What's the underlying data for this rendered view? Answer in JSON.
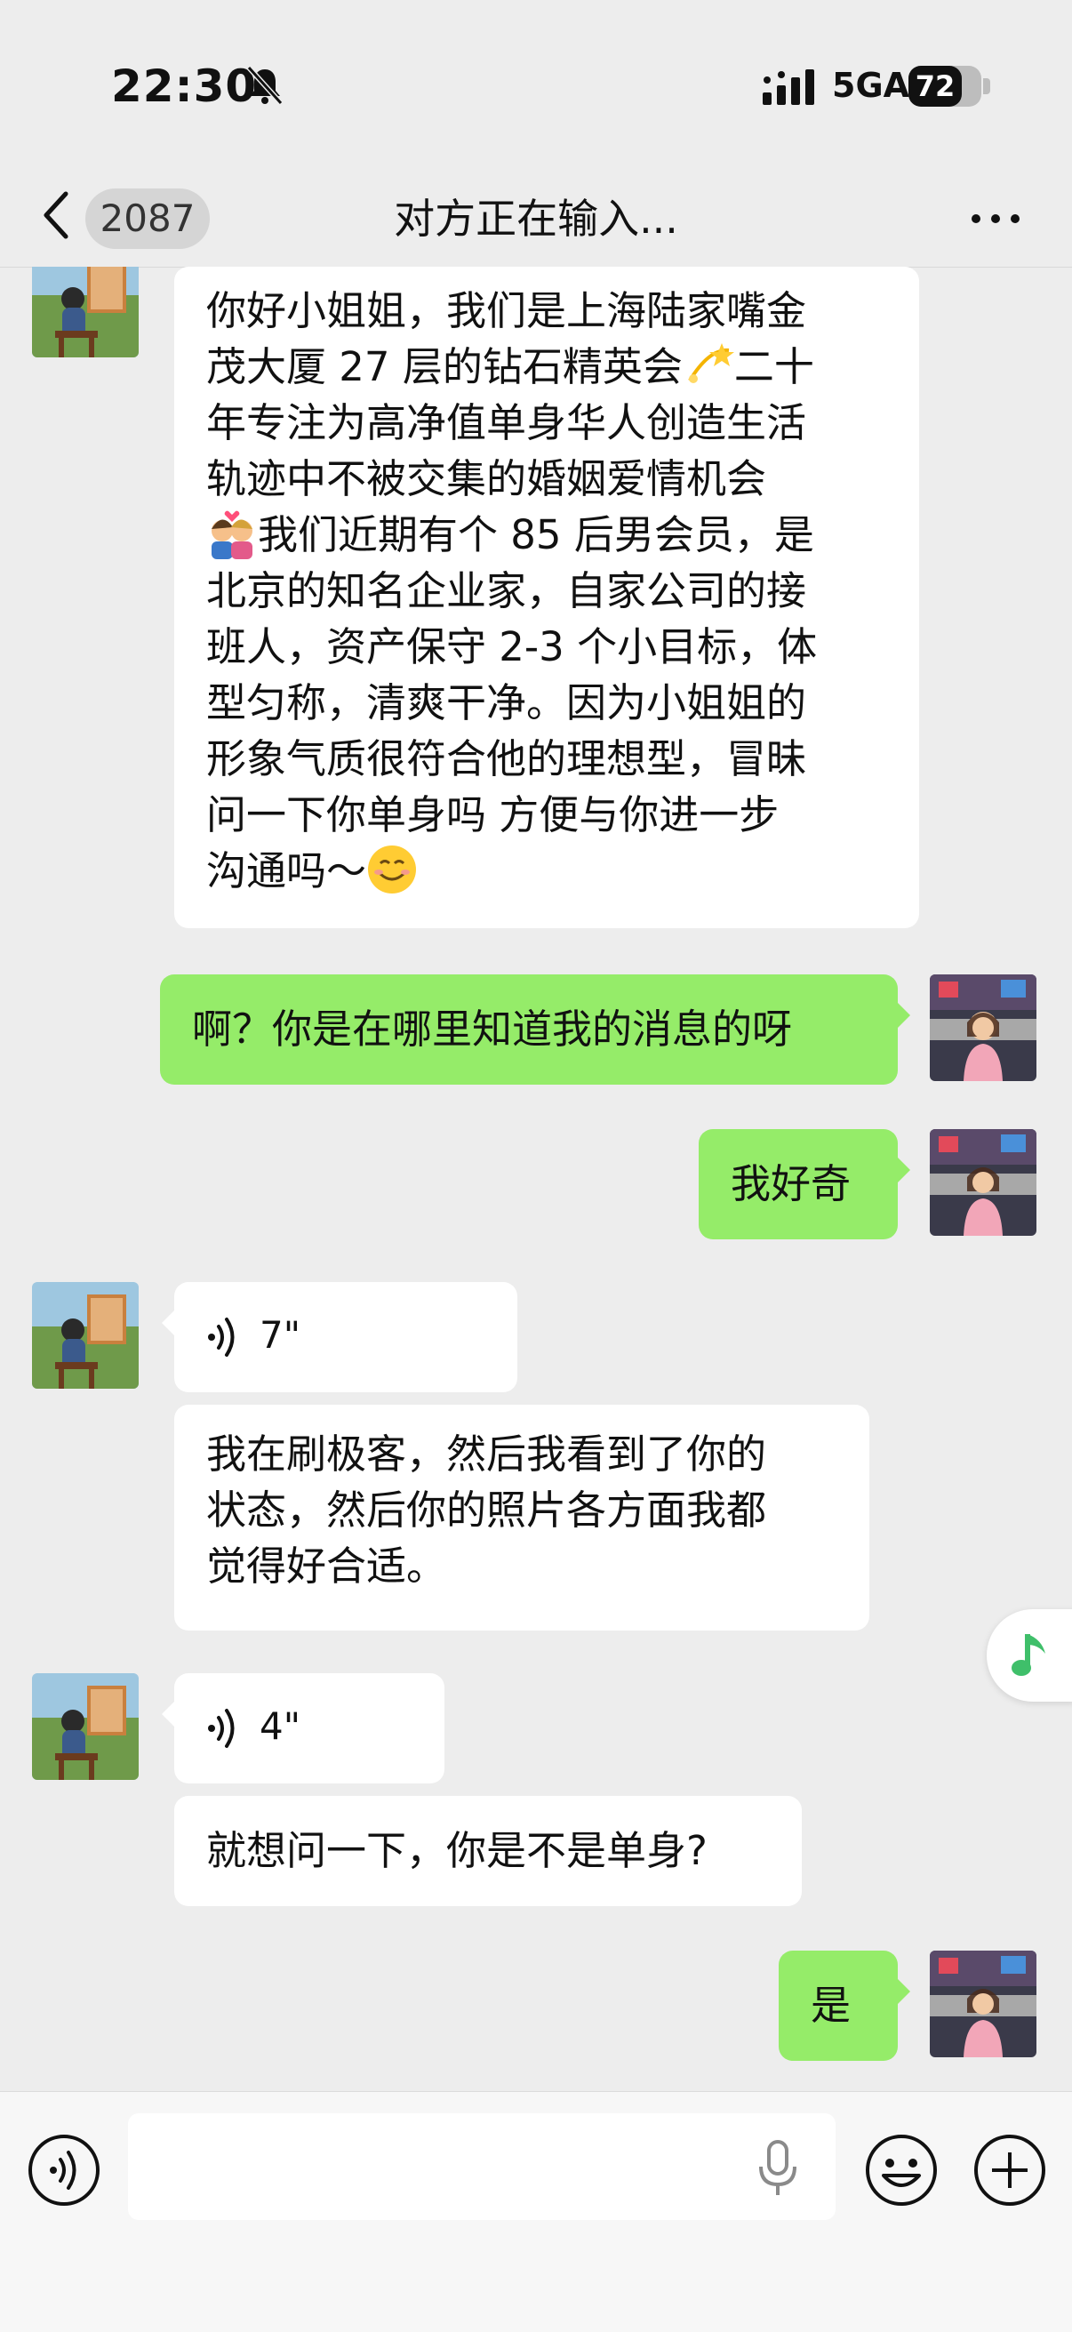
{
  "status_bar": {
    "time": "22:30",
    "network": "5GA",
    "battery": "72",
    "icons": [
      "bell-muted-icon",
      "signal-icon",
      "battery-icon"
    ]
  },
  "nav": {
    "back_count": "2087",
    "title": "对方正在输入...",
    "icons": [
      "back-chevron-icon",
      "more-icon"
    ]
  },
  "colors": {
    "background": "#ededed",
    "bubble_sent": "#95ec69",
    "bubble_received": "#ffffff",
    "accent": "#07c160"
  },
  "messages": [
    {
      "side": "left",
      "type": "text",
      "parts": [
        "你好小姐姐，我们是上海陆家嘴金",
        "茂大厦 27 层的钻石精英会",
        "二十",
        "年专注为高净值单身华人创造生活",
        "轨迹中不被交集的婚姻爱情机会",
        "我们近期有个 85 后男会员，是",
        "北京的知名企业家，自家公司的接",
        "班人，资产保守 2-3 个小目标，体",
        "型匀称，清爽干净。因为小姐姐的",
        "形象气质很符合他的理想型，冒昧",
        "问一下你单身吗 方便与你进一步",
        "沟通吗～"
      ],
      "emojis": [
        "dizzy-star-emoji",
        "couple-kiss-emoji",
        "smiling-face-emoji"
      ]
    },
    {
      "side": "right",
      "type": "text",
      "text": "啊？你是在哪里知道我的消息的呀"
    },
    {
      "side": "right",
      "type": "text",
      "text": "我好奇"
    },
    {
      "side": "left",
      "type": "voice",
      "duration": "7\""
    },
    {
      "side": "left",
      "type": "text",
      "lines": [
        "我在刷极客，然后我看到了你的",
        "状态，然后你的照片各方面我都",
        "觉得好合适。"
      ]
    },
    {
      "side": "left",
      "type": "voice",
      "duration": "4\""
    },
    {
      "side": "left",
      "type": "text",
      "text": "就想问一下，你是不是单身?"
    },
    {
      "side": "right",
      "type": "text",
      "text": "是"
    }
  ],
  "input_bar": {
    "placeholder": "",
    "icons": [
      "voice-mode-icon",
      "microphone-icon",
      "emoji-icon",
      "plus-icon"
    ]
  },
  "floating": {
    "icon": "music-note-icon"
  }
}
